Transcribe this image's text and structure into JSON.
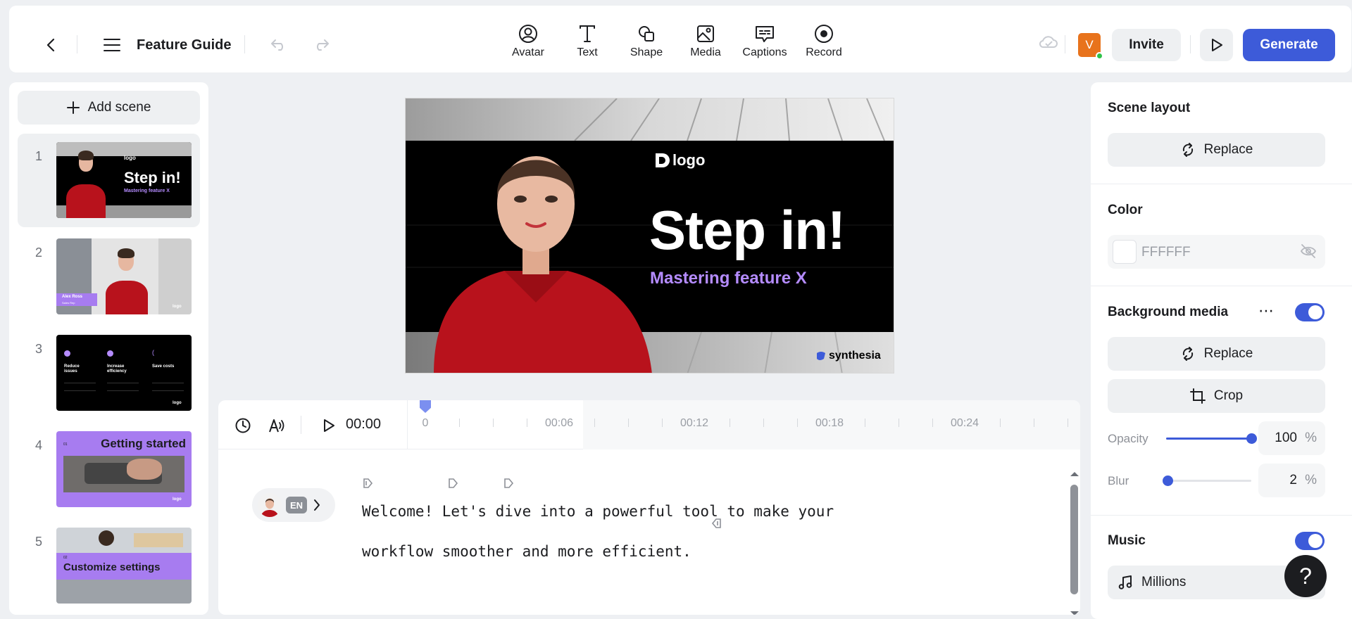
{
  "header": {
    "title": "Feature Guide",
    "tools": [
      {
        "label": "Avatar",
        "icon": "avatar-icon"
      },
      {
        "label": "Text",
        "icon": "text-icon"
      },
      {
        "label": "Shape",
        "icon": "shape-icon"
      },
      {
        "label": "Media",
        "icon": "media-icon"
      },
      {
        "label": "Captions",
        "icon": "captions-icon"
      },
      {
        "label": "Record",
        "icon": "record-icon"
      }
    ],
    "user_initial": "V",
    "invite_label": "Invite",
    "generate_label": "Generate",
    "accent_color": "#3d5bd9"
  },
  "sidebar": {
    "add_scene_label": "Add scene",
    "scenes": [
      {
        "number": "1",
        "title": "Step in!",
        "subtitle": "Mastering feature X",
        "logo": "logo"
      },
      {
        "number": "2",
        "name_tag": "Alex Ross",
        "name_sub": "Sales Rep",
        "logo": "logo"
      },
      {
        "number": "3",
        "col1": "Reduce issues",
        "col2": "Increase efficiency",
        "col3": "Save costs",
        "logo": "logo"
      },
      {
        "number": "4",
        "index": "01",
        "title": "Getting started",
        "logo": "logo"
      },
      {
        "number": "5",
        "index": "02",
        "title": "Customize settings"
      }
    ]
  },
  "canvas": {
    "logo_text": "logo",
    "headline": "Step in!",
    "subheadline": "Mastering feature X",
    "watermark": "synthesia"
  },
  "timeline": {
    "current_time": "00:00",
    "ticks": [
      "0",
      "00:06",
      "00:12",
      "00:18",
      "00:24"
    ]
  },
  "script": {
    "language": "EN",
    "line1": "Welcome! Let's dive into a powerful tool to make your",
    "line2": "workflow smoother and more efficient."
  },
  "panel": {
    "scene_layout_title": "Scene layout",
    "replace_label": "Replace",
    "color_title": "Color",
    "color_value": "FFFFFF",
    "background_media_title": "Background media",
    "bg_replace_label": "Replace",
    "crop_label": "Crop",
    "opacity_label": "Opacity",
    "opacity_value": "100",
    "opacity_fraction": 1.0,
    "blur_label": "Blur",
    "blur_value": "2",
    "blur_fraction": 0.02,
    "percent": "%",
    "music_title": "Music",
    "music_track": "Millions"
  },
  "help_label": "?"
}
